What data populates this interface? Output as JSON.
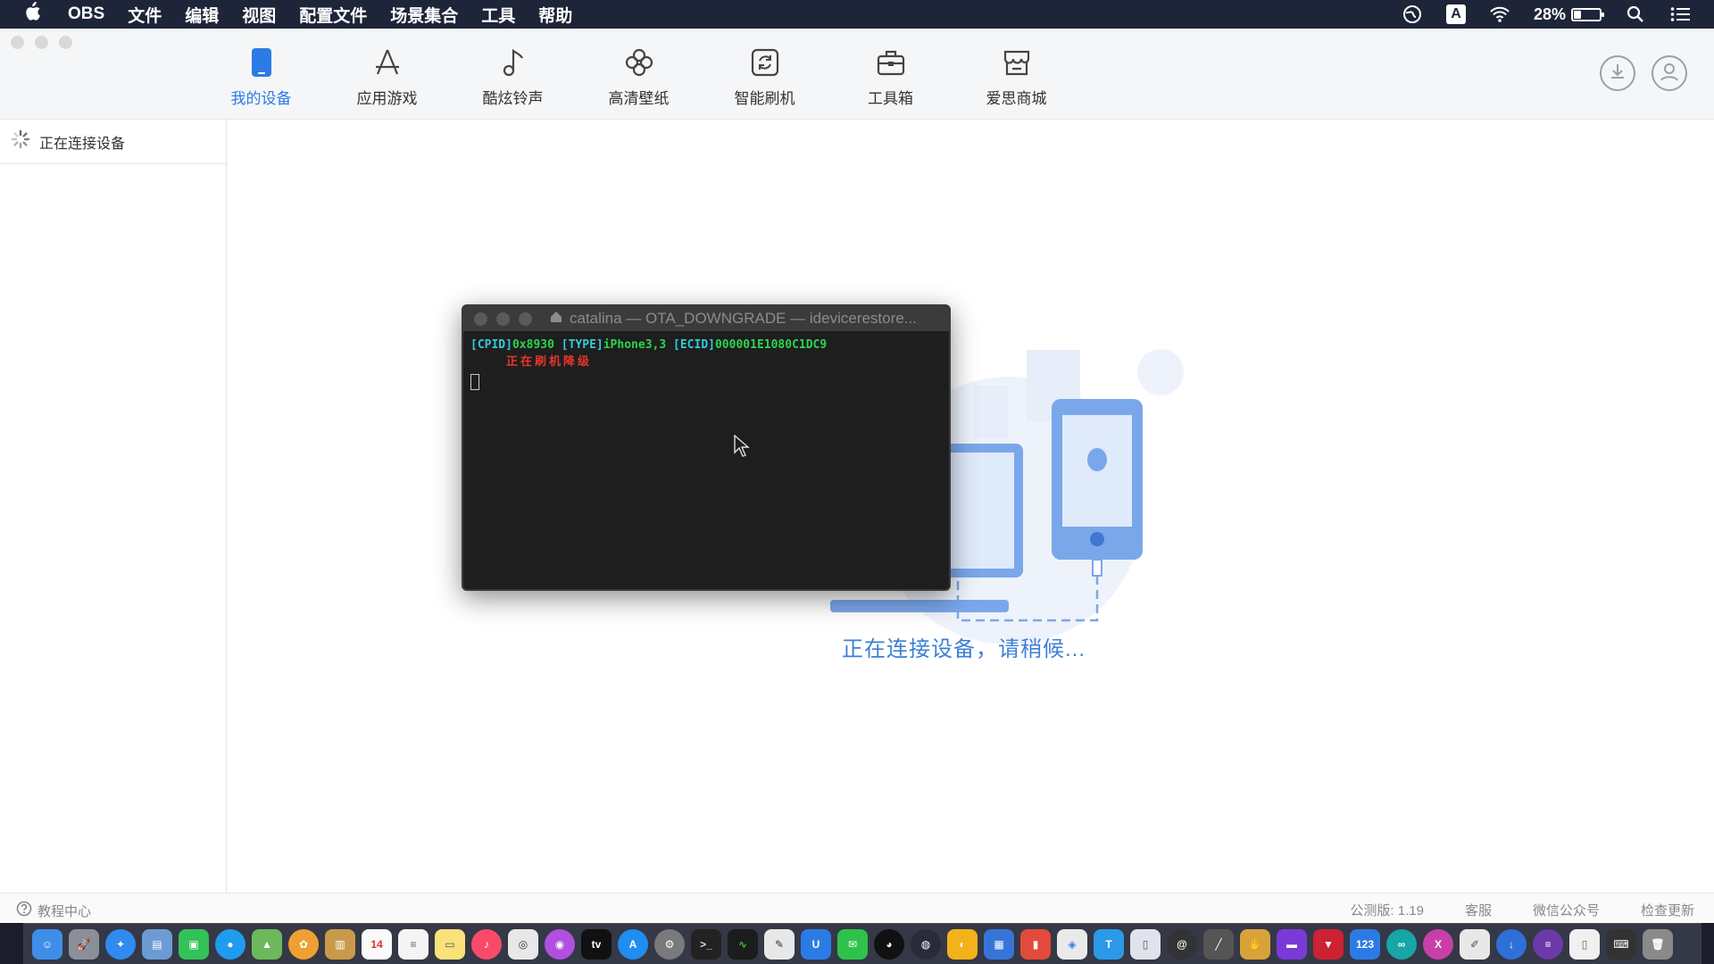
{
  "menubar": {
    "app_name": "OBS",
    "items": [
      "文件",
      "编辑",
      "视图",
      "配置文件",
      "场景集合",
      "工具",
      "帮助"
    ],
    "battery_percent": "28%",
    "battery_level": 0.28,
    "input_method": "A"
  },
  "toolbar": {
    "nav": [
      {
        "label": "我的设备",
        "icon": "device-icon",
        "active": true
      },
      {
        "label": "应用游戏",
        "icon": "app-store-icon",
        "active": false
      },
      {
        "label": "酷炫铃声",
        "icon": "music-note-icon",
        "active": false
      },
      {
        "label": "高清壁纸",
        "icon": "flower-icon",
        "active": false
      },
      {
        "label": "智能刷机",
        "icon": "refresh-icon",
        "active": false
      },
      {
        "label": "工具箱",
        "icon": "toolbox-icon",
        "active": false
      },
      {
        "label": "爱思商城",
        "icon": "store-icon",
        "active": false
      }
    ]
  },
  "sidebar": {
    "connecting_label": "正在连接设备"
  },
  "main": {
    "connecting_message": "正在连接设备，请稍候..."
  },
  "terminal": {
    "title": "catalina — OTA_DOWNGRADE — idevicerestore...",
    "line1_cpid_label": "[CPID]",
    "line1_cpid_value": "0x8930",
    "line1_type_label": "[TYPE]",
    "line1_type_value": "iPhone3,3",
    "line1_ecid_label": "[ECID]",
    "line1_ecid_value": "000001E1080C1DC9",
    "line2": "正在刷机降级"
  },
  "statusbar": {
    "help": "教程中心",
    "version": "公测版: 1.19",
    "service": "客服",
    "wechat": "微信公众号",
    "update": "检查更新"
  },
  "colors": {
    "accent": "#2c7be5",
    "menubar_bg": "#1f2538",
    "terminal_bg": "#1e1e1e"
  }
}
